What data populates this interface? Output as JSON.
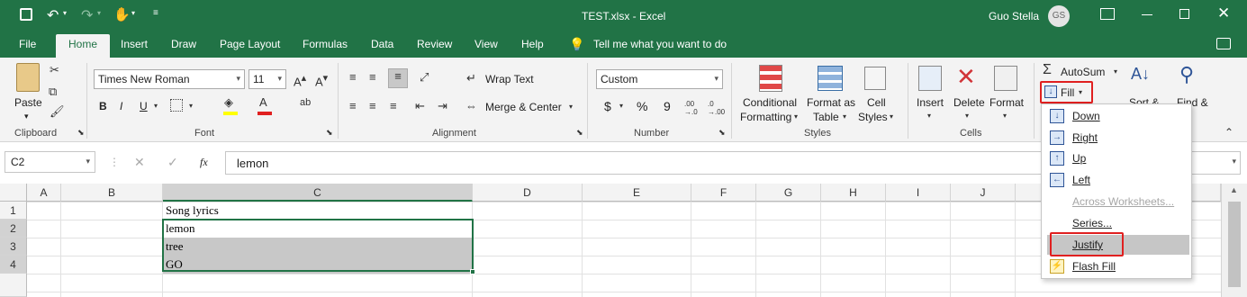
{
  "title": {
    "doc": "TEST.xlsx  -  Excel",
    "user": "Guo Stella",
    "avatar": "GS"
  },
  "tabs": [
    "File",
    "Home",
    "Insert",
    "Draw",
    "Page Layout",
    "Formulas",
    "Data",
    "Review",
    "View",
    "Help"
  ],
  "tellme": "Tell me what you want to do",
  "clipboard": {
    "paste": "Paste",
    "label": "Clipboard"
  },
  "font": {
    "name": "Times New Roman",
    "size": "11",
    "label": "Font",
    "bold": "B",
    "italic": "I",
    "underline": "U"
  },
  "alignment": {
    "wrap": "Wrap Text",
    "merge": "Merge & Center",
    "label": "Alignment"
  },
  "number": {
    "format": "Custom",
    "label": "Number",
    "dollar": "$",
    "percent": "%",
    "comma": "9"
  },
  "styles": {
    "cond1": "Conditional",
    "cond2": "Formatting",
    "fmt1": "Format as",
    "fmt2": "Table",
    "cell1": "Cell",
    "cell2": "Styles",
    "label": "Styles"
  },
  "cells": {
    "insert": "Insert",
    "delete": "Delete",
    "format": "Format",
    "label": "Cells"
  },
  "editing": {
    "autosum": "AutoSum",
    "fill": "Fill",
    "sort": "Sort &",
    "find": "Find &"
  },
  "formula": {
    "namebox": "C2",
    "fx": "fx",
    "value": "lemon"
  },
  "columns": [
    "A",
    "B",
    "C",
    "D",
    "E",
    "F",
    "G",
    "H",
    "I",
    "J"
  ],
  "rows": [
    "1",
    "2",
    "3",
    "4"
  ],
  "cellvals": {
    "c1": "Song lyrics",
    "c2": "lemon",
    "c3": "tree",
    "c4": "GO"
  },
  "fillmenu": {
    "down": "Down",
    "right": "Right",
    "up": "Up",
    "left": "Left",
    "across": "Across Worksheets...",
    "series": "Series...",
    "justify": "Justify",
    "flash": "Flash Fill"
  },
  "colors": {
    "excel_green": "#217346",
    "highlight": "#e02020",
    "selected_fill": "#c8c8c8"
  }
}
